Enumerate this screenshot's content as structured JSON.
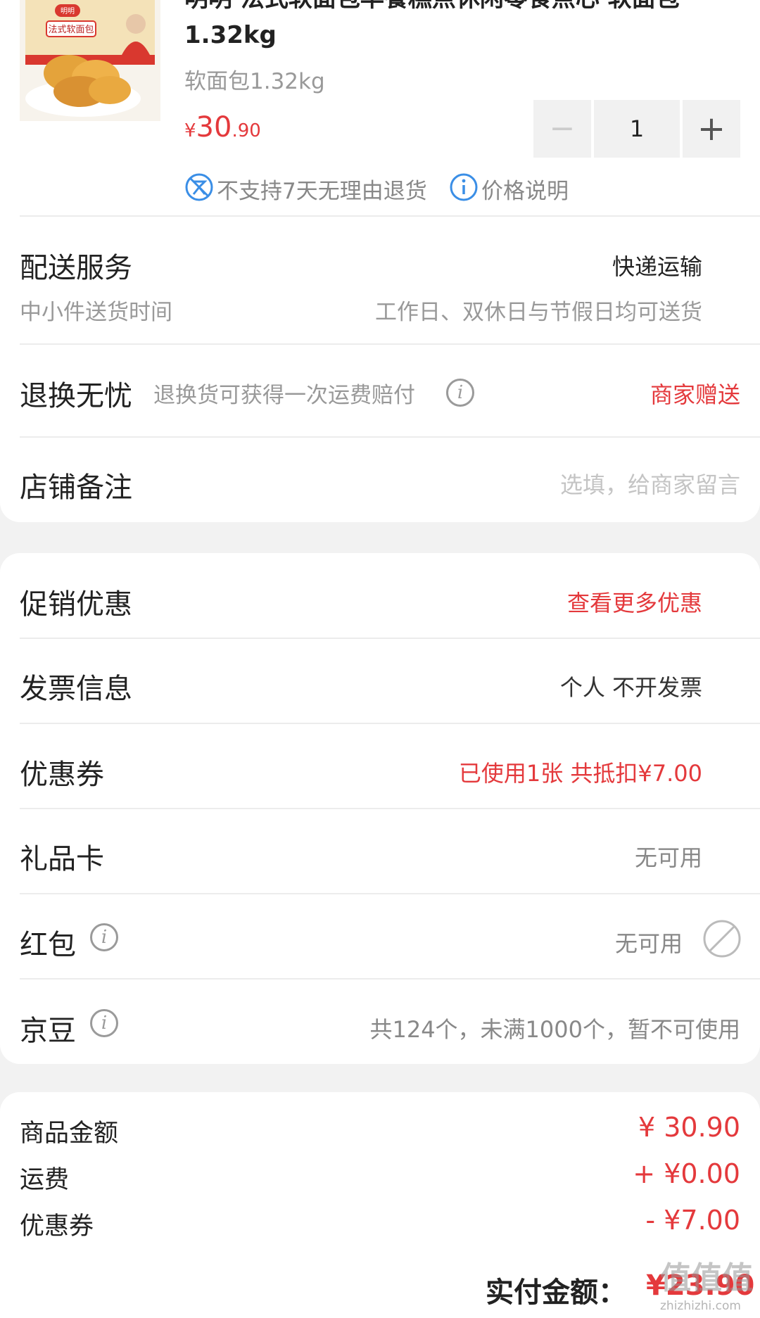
{
  "product": {
    "title_line1": "明明 法式软面包早餐糕点休闲零食点心 软面包",
    "title_line2": "1.32kg",
    "spec": "软面包1.32kg",
    "price_symbol": "¥",
    "price_int": "30",
    "price_dec": ".90",
    "quantity": "1",
    "minus": "−",
    "plus": "+",
    "no_return": "不支持7天无理由退货",
    "price_note": "价格说明",
    "box_text": "法式软面包",
    "box_logo": "明明"
  },
  "delivery": {
    "label": "配送服务",
    "value": "快递运输",
    "sub_label": "中小件送货时间",
    "sub_value": "工作日、双休日与节假日均可送货"
  },
  "return_service": {
    "label": "退换无忧",
    "desc": "退换货可获得一次运费赔付",
    "value": "商家赠送"
  },
  "shop_note": {
    "label": "店铺备注",
    "placeholder": "选填，给商家留言"
  },
  "promo": {
    "label": "促销优惠",
    "value": "查看更多优惠"
  },
  "invoice": {
    "label": "发票信息",
    "value": "个人 不开发票"
  },
  "coupon": {
    "label": "优惠券",
    "value": "已使用1张 共抵扣¥7.00"
  },
  "gift_card": {
    "label": "礼品卡",
    "value": "无可用"
  },
  "red_packet": {
    "label": "红包",
    "value": "无可用"
  },
  "jd_beans": {
    "label": "京豆",
    "value": "共124个，未满1000个，暂不可使用"
  },
  "summary": {
    "goods_label": "商品金额",
    "goods_value": "¥ 30.90",
    "shipping_label": "运费",
    "shipping_value": "+ ¥0.00",
    "coupon_label": "优惠券",
    "coupon_value": "- ¥7.00",
    "total_label": "实付金额：",
    "total_value": "¥23.90"
  },
  "watermark": {
    "main": "值值值",
    "sub": "zhizhizhi.com"
  },
  "colors": {
    "accent": "#e4393c",
    "blue": "#3a8ee6",
    "grey": "#999999"
  }
}
